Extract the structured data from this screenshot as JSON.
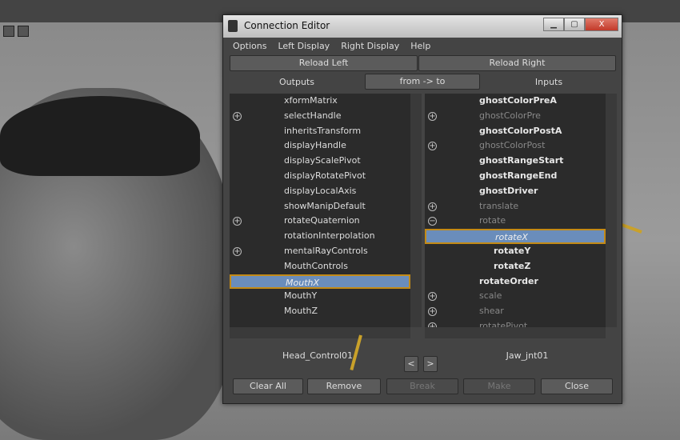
{
  "window": {
    "title": "Connection Editor",
    "minimize": "▁",
    "maximize": "▢",
    "close": "X"
  },
  "menu": [
    "Options",
    "Left Display",
    "Right Display",
    "Help"
  ],
  "reload_left": "Reload Left",
  "reload_right": "Reload Right",
  "outputs_label": "Outputs",
  "direction": "from -> to",
  "inputs_label": "Inputs",
  "left_list": [
    {
      "label": "xformMatrix",
      "expand": ""
    },
    {
      "label": "selectHandle",
      "expand": "+"
    },
    {
      "label": "inheritsTransform",
      "expand": ""
    },
    {
      "label": "displayHandle",
      "expand": ""
    },
    {
      "label": "displayScalePivot",
      "expand": ""
    },
    {
      "label": "displayRotatePivot",
      "expand": ""
    },
    {
      "label": "displayLocalAxis",
      "expand": ""
    },
    {
      "label": "showManipDefault",
      "expand": ""
    },
    {
      "label": "rotateQuaternion",
      "expand": "+"
    },
    {
      "label": "rotationInterpolation",
      "expand": ""
    },
    {
      "label": "mentalRayControls",
      "expand": "+"
    },
    {
      "label": "MouthControls",
      "expand": ""
    },
    {
      "label": "MouthX",
      "expand": "",
      "selected": true
    },
    {
      "label": "MouthY",
      "expand": ""
    },
    {
      "label": "MouthZ",
      "expand": ""
    }
  ],
  "right_list": [
    {
      "label": "ghostColorPreA",
      "style": "b",
      "expand": ""
    },
    {
      "label": "ghostColorPre",
      "style": "g",
      "expand": "+"
    },
    {
      "label": "ghostColorPostA",
      "style": "b",
      "expand": ""
    },
    {
      "label": "ghostColorPost",
      "style": "g",
      "expand": "+"
    },
    {
      "label": "ghostRangeStart",
      "style": "b",
      "expand": ""
    },
    {
      "label": "ghostRangeEnd",
      "style": "b",
      "expand": ""
    },
    {
      "label": "ghostDriver",
      "style": "b",
      "expand": ""
    },
    {
      "label": "translate",
      "style": "g",
      "expand": "+"
    },
    {
      "label": "rotate",
      "style": "g",
      "expand": "−"
    },
    {
      "label": "rotateX",
      "style": "sel",
      "expand": "",
      "indent": true
    },
    {
      "label": "rotateY",
      "style": "b",
      "expand": "",
      "indent": true
    },
    {
      "label": "rotateZ",
      "style": "b",
      "expand": "",
      "indent": true
    },
    {
      "label": "rotateOrder",
      "style": "b",
      "expand": ""
    },
    {
      "label": "scale",
      "style": "g",
      "expand": "+"
    },
    {
      "label": "shear",
      "style": "g",
      "expand": "+"
    },
    {
      "label": "rotatePivot",
      "style": "g",
      "expand": "+"
    }
  ],
  "left_node": "Head_Control01",
  "right_node": "Jaw_jnt01",
  "nav_prev": "<",
  "nav_next": ">",
  "buttons": {
    "clear_all": "Clear All",
    "remove": "Remove",
    "break": "Break",
    "make": "Make",
    "close": "Close"
  },
  "colors": {
    "selection": "#6a8dbb",
    "highlight_border": "#c38a16",
    "annotation_arrow": "#c9a12a"
  }
}
